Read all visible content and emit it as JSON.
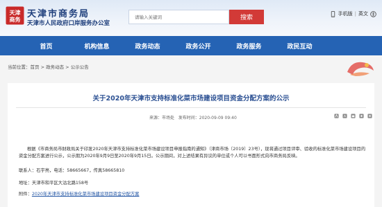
{
  "header": {
    "logo_text": "天津商务",
    "title": "天津市商务局",
    "subtitle": "天津市人民政府口岸服务办公室",
    "search_placeholder": "请输入关键词",
    "search_button": "搜索",
    "links": {
      "mobile": "手机版",
      "english": "英文"
    }
  },
  "nav": {
    "items": [
      {
        "label": "首页"
      },
      {
        "label": "机构信息"
      },
      {
        "label": "政务动态"
      },
      {
        "label": "政务公开"
      },
      {
        "label": "政务服务"
      },
      {
        "label": "政民互动"
      }
    ],
    "color": "#2563b4"
  },
  "breadcrumb": {
    "current_label": "当前位置：",
    "items": [
      "首页",
      "政务动态",
      "公示公告"
    ],
    "separator": " > "
  },
  "article": {
    "title": "关于2020年天津市支持标准化菜市场建设项目资金分配方案的公示",
    "source": "来源：市场处",
    "date": "发布时间：2020-09-09 09:40",
    "paragraph": "根据《市商务局市财政局关于印发2020年天津市支持标准化菜市场建设项目申报指南的通知》（津商市场〔2019〕23号），现将通过项目评审、验收的标准化菜市场建设项目的资金分配方案进行公示，公示期为2020年9月9日至2020年9月15日。公示期间，对上述结果有异议的单位或个人可以书面形式向市商务局反映。",
    "contact": "联系人：石宇亮，电话：58665667，传真58665810",
    "address": "地址：天津市和平区大沽北路158号",
    "attachment_label": "附件：",
    "attachment_link": "2020年天津市支持标准化菜市场建设项目资金分配方案"
  },
  "tool_icons": [
    "font-large-icon",
    "font-small-icon",
    "print-icon",
    "share-icon",
    "close-icon"
  ]
}
